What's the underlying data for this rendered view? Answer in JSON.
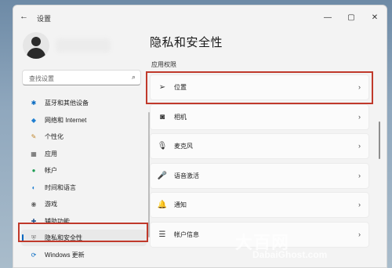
{
  "window": {
    "back": "←",
    "title": "设置",
    "controls": [
      "—",
      "▢",
      "✕"
    ]
  },
  "sidebar": {
    "search_placeholder": "查找设置",
    "search_icon": "⌕",
    "items": [
      {
        "icon": "bluetooth-icon",
        "glyph": "✱",
        "label": "蓝牙和其他设备"
      },
      {
        "icon": "network-icon",
        "glyph": "◆",
        "label": "网络和 Internet"
      },
      {
        "icon": "personalization-icon",
        "glyph": "✎",
        "label": "个性化"
      },
      {
        "icon": "apps-icon",
        "glyph": "▦",
        "label": "应用"
      },
      {
        "icon": "accounts-icon",
        "glyph": "●",
        "label": "帐户"
      },
      {
        "icon": "time-language-icon",
        "glyph": "◐",
        "label": "时间和语言"
      },
      {
        "icon": "gaming-icon",
        "glyph": "◉",
        "label": "游戏"
      },
      {
        "icon": "accessibility-icon",
        "glyph": "✚",
        "label": "辅助功能"
      },
      {
        "icon": "privacy-icon",
        "glyph": "⛨",
        "label": "隐私和安全性"
      },
      {
        "icon": "windows-update-icon",
        "glyph": "⟳",
        "label": "Windows 更新"
      }
    ],
    "active_index": 8
  },
  "main": {
    "title": "隐私和安全性",
    "section": "应用权限",
    "rows": [
      {
        "icon": "location-icon",
        "glyph": "➢",
        "label": "位置"
      },
      {
        "icon": "camera-icon",
        "glyph": "◙",
        "label": "相机"
      },
      {
        "icon": "microphone-icon",
        "glyph": "🎙",
        "label": "麦克风"
      },
      {
        "icon": "voice-activation-icon",
        "glyph": "🎤",
        "label": "语音激活"
      },
      {
        "icon": "notifications-icon",
        "glyph": "🔔",
        "label": "通知"
      },
      {
        "icon": "account-info-icon",
        "glyph": "☰",
        "label": "帐户信息"
      }
    ],
    "chevron": "›"
  },
  "watermark": {
    "main": "大百网",
    "sub": "DabaiGhost.com"
  }
}
